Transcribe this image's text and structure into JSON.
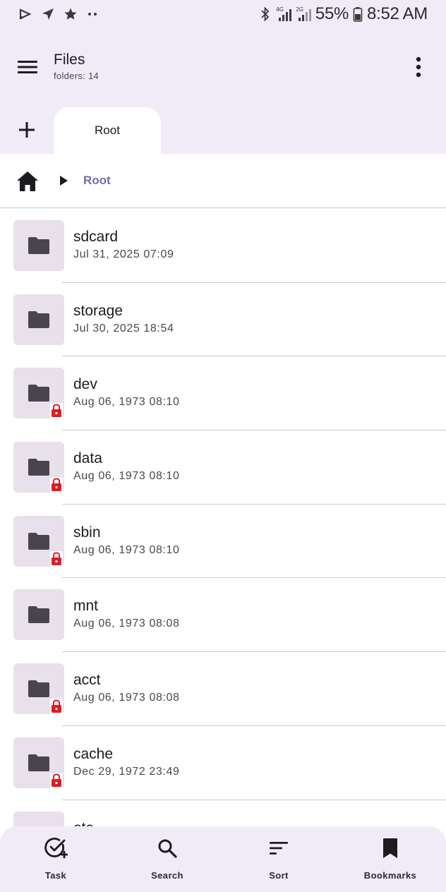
{
  "status_bar": {
    "battery": "55%",
    "time": "8:52 AM",
    "net1": "4G",
    "net2": "2G"
  },
  "app_bar": {
    "title": "Files",
    "subtitle": "folders: 14"
  },
  "tabs": [
    {
      "label": "Root"
    }
  ],
  "breadcrumb": {
    "current": "Root"
  },
  "files": [
    {
      "name": "sdcard",
      "date": "Jul 31, 2025 07:09",
      "locked": false
    },
    {
      "name": "storage",
      "date": "Jul 30, 2025 18:54",
      "locked": false
    },
    {
      "name": "dev",
      "date": "Aug 06, 1973 08:10",
      "locked": true
    },
    {
      "name": "data",
      "date": "Aug 06, 1973 08:10",
      "locked": true
    },
    {
      "name": "sbin",
      "date": "Aug 06, 1973 08:10",
      "locked": true
    },
    {
      "name": "mnt",
      "date": "Aug 06, 1973 08:08",
      "locked": false
    },
    {
      "name": "acct",
      "date": "Aug 06, 1973 08:08",
      "locked": true
    },
    {
      "name": "cache",
      "date": "Dec 29, 1972 23:49",
      "locked": true
    },
    {
      "name": "etc",
      "date": "",
      "locked": false
    }
  ],
  "bottom_nav": [
    {
      "label": "Task",
      "icon": "task-check-icon"
    },
    {
      "label": "Search",
      "icon": "search-icon"
    },
    {
      "label": "Sort",
      "icon": "sort-icon"
    },
    {
      "label": "Bookmarks",
      "icon": "bookmark-icon"
    }
  ],
  "colors": {
    "surface_tint": "#f1ebf8",
    "accent": "#7a6aa3",
    "lock": "#e01b24",
    "folder": "#48454e"
  }
}
